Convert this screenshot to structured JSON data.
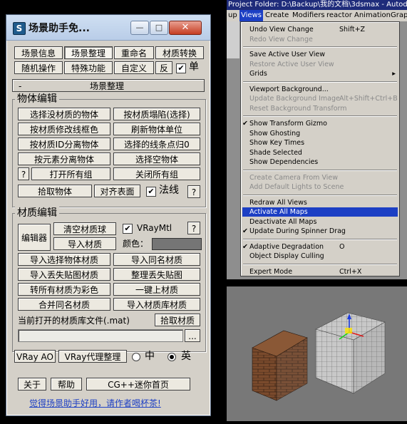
{
  "plugin": {
    "title": "场景助手免...",
    "caption_buttons": {
      "minimize": "—",
      "maximize": "□",
      "close": "✕"
    },
    "tabs_row1": [
      "场景信息",
      "场景整理",
      "重命名",
      "材质转换"
    ],
    "tabs_row2": [
      "随机操作",
      "特殊功能",
      "自定义",
      "反"
    ],
    "tab_checkbox_label": "单",
    "rollout_sign": "-",
    "rollout_title": "场景整理",
    "object_group": {
      "title": "物体编辑",
      "buttons": [
        "选择没材质的物体",
        "按材质塌陷(选择)",
        "按材质修改线框色",
        "刷新物体单位",
        "按材质ID分离物体",
        "选择的线条点归0",
        "按元素分离物体",
        "选择空物体",
        "?",
        "打开所有组",
        "关闭所有组",
        "拾取物体",
        "对齐表面"
      ],
      "normal_label": "法线",
      "help": "?"
    },
    "material_group": {
      "title": "材质编辑",
      "editor_btn": "编辑器",
      "clear_btn": "清空材质球",
      "import_btn": "导入材质",
      "vraymtl_label": "VRayMtl",
      "help": "?",
      "color_label": "颜色：",
      "swatch_color": "#757575",
      "buttons": [
        "导入选择物体材质",
        "导入同名材质",
        "导入丢失贴图材质",
        "整理丢失贴图",
        "转所有材质为彩色",
        "一键上材质",
        "合并同名材质",
        "导入材质库材质"
      ],
      "lib_label": "当前打开的材质库文件(.mat)",
      "pick_btn": "拾取材质",
      "lib_path": "",
      "browse_btn": "..."
    },
    "bottom_row": {
      "vray_ao": "VRay AO",
      "vray_proxy": "VRay代理整理",
      "lang_cn": "中",
      "lang_en": "英",
      "selected_lang": "英"
    },
    "footer": {
      "about": "关于",
      "help": "帮助",
      "homepage": "CG++迷你首页",
      "donate_link": "觉得场景助手好用，请作者喝杯茶!"
    }
  },
  "maxwin": {
    "title": "Project Folder: D:\\Backup\\我的文档\\3dsmax     - Autodesk",
    "menubar": [
      "up",
      "Views",
      "Create",
      "Modifiers",
      "reactor",
      "Animation",
      "Graph"
    ],
    "active_menu": "Views",
    "menu": [
      {
        "label": "Undo View Change",
        "shortcut": "Shift+Z",
        "disabled": false
      },
      {
        "label": "Redo View Change",
        "shortcut": "",
        "disabled": true
      },
      {
        "sep": true
      },
      {
        "label": "Save Active User View",
        "shortcut": "",
        "disabled": false
      },
      {
        "label": "Restore Active User View",
        "shortcut": "",
        "disabled": true
      },
      {
        "label": "Grids",
        "shortcut": "",
        "disabled": false,
        "submenu": true
      },
      {
        "sep": true
      },
      {
        "label": "Viewport Background...",
        "shortcut": "",
        "disabled": false
      },
      {
        "label": "Update Background Image",
        "shortcut": "Alt+Shift+Ctrl+B",
        "disabled": true
      },
      {
        "label": "Reset Background Transform",
        "shortcut": "",
        "disabled": true
      },
      {
        "sep": true
      },
      {
        "label": "Show Transform Gizmo",
        "shortcut": "",
        "disabled": false,
        "checked": true
      },
      {
        "label": "Show Ghosting",
        "shortcut": "",
        "disabled": false
      },
      {
        "label": "Show Key Times",
        "shortcut": "",
        "disabled": false
      },
      {
        "label": "Shade Selected",
        "shortcut": "",
        "disabled": false
      },
      {
        "label": "Show Dependencies",
        "shortcut": "",
        "disabled": false
      },
      {
        "sep": true
      },
      {
        "label": "Create Camera From View",
        "shortcut": "",
        "disabled": true
      },
      {
        "label": "Add Default Lights to Scene",
        "shortcut": "",
        "disabled": true
      },
      {
        "sep": true
      },
      {
        "label": "Redraw All Views",
        "shortcut": "",
        "disabled": false
      },
      {
        "label": "Activate All Maps",
        "shortcut": "",
        "disabled": false,
        "highlighted": true
      },
      {
        "label": "Deactivate All Maps",
        "shortcut": "",
        "disabled": false
      },
      {
        "label": "Update During Spinner Drag",
        "shortcut": "",
        "disabled": false,
        "checked": true
      },
      {
        "sep": true
      },
      {
        "label": "Adaptive Degradation",
        "shortcut": "O",
        "disabled": false,
        "checked": true
      },
      {
        "label": "Object Display Culling",
        "shortcut": "",
        "disabled": false
      },
      {
        "sep": true
      },
      {
        "label": "Expert Mode",
        "shortcut": "Ctrl+X",
        "disabled": false
      }
    ]
  },
  "viewport": {
    "background": "#787878",
    "brick_color": "#7a4a2c",
    "mesh_color": "#c8c8c8"
  }
}
